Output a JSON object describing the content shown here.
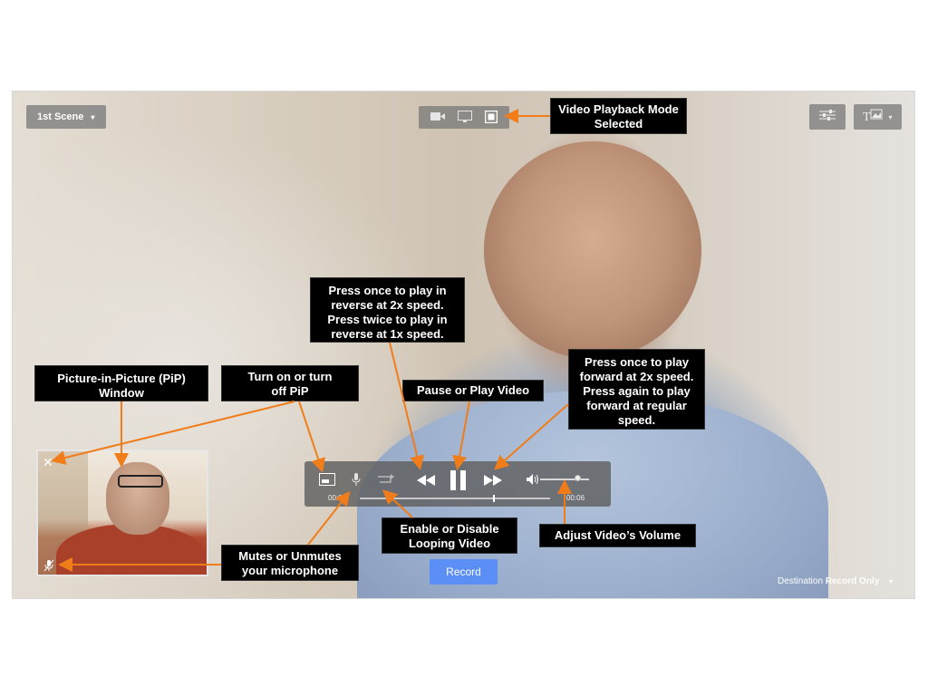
{
  "toolbar": {
    "scene_label": "1st Scene",
    "scene_caret": "▾",
    "overlay_caret": "▾"
  },
  "mode_icons": [
    "camera-icon",
    "monitor-icon",
    "film-icon"
  ],
  "controls": {
    "time_current": "00:00",
    "time_total": "00:06",
    "progress_fraction": 0.7,
    "volume_fraction": 0.75
  },
  "record_label": "Record",
  "destination": {
    "label": "Destination",
    "value": "Record Only",
    "caret": "▾"
  },
  "callouts": {
    "playback_mode": "Video Playback Mode Selected",
    "reverse": "Press once to play in reverse at 2x speed. Press twice to play in reverse at 1x speed.",
    "pip_window": "Picture-in-Picture (PiP) Window",
    "pip_toggle": "Turn on or turn off PiP",
    "pause_play": "Pause or Play Video",
    "forward": "Press once to play forward at 2x speed. Press again to play forward at regular speed.",
    "looping": "Enable or Disable Looping Video",
    "volume": "Adjust Video’s Volume",
    "mic": "Mutes or Unmutes your microphone"
  },
  "colors": {
    "record_button": "#5b8ff5",
    "callout_bg": "#000000",
    "arrow": "#f07d1a"
  }
}
